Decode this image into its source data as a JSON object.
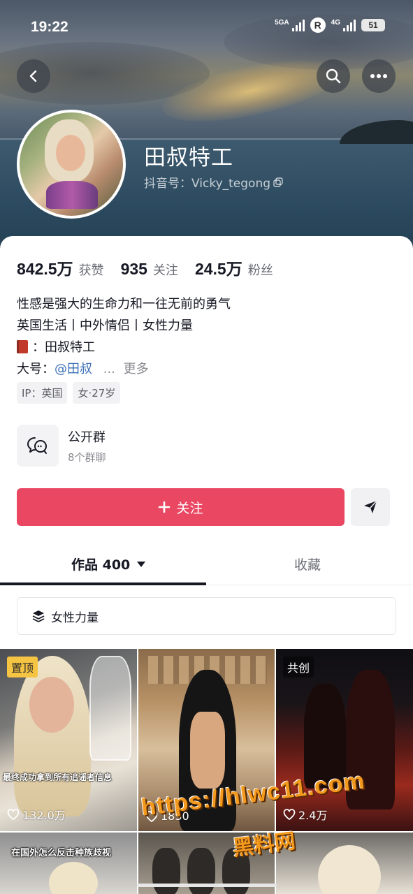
{
  "status_bar": {
    "time": "19:22",
    "network1": "5GA",
    "roaming": "R",
    "network2": "4G",
    "battery": "51"
  },
  "profile": {
    "name": "田叔特工",
    "douyin_id": "抖音号：Vicky_tegong"
  },
  "stats": [
    {
      "value": "842.5万",
      "label": "获赞"
    },
    {
      "value": "935",
      "label": "关注"
    },
    {
      "value": "24.5万",
      "label": "粉丝"
    }
  ],
  "bio": {
    "line1": "性感是强大的生命力和一往无前的勇气",
    "line2": "英国生活丨中外情侣丨女性力量",
    "line3_text": "：田叔特工",
    "line4_prefix": "大号：",
    "line4_link": "@田叔",
    "line4_ellipsis": "...",
    "more": "更多"
  },
  "tags": [
    "IP：英国",
    "女·27岁"
  ],
  "group": {
    "title": "公开群",
    "subtitle": "8个群聊"
  },
  "actions": {
    "follow_label": "关注"
  },
  "tabs": {
    "works": "作品 400",
    "favorites": "收藏"
  },
  "collection": {
    "label": "女性力量"
  },
  "videos": [
    {
      "badge": "置顶",
      "caption": "最终成功拿到所有追谣者信息",
      "likes": "132.0万"
    },
    {
      "badge": "",
      "caption": "",
      "likes": "1830"
    },
    {
      "badge": "共创",
      "caption": "",
      "likes": "2.4万"
    },
    {
      "caption": "在国外怎么反击种族歧视"
    }
  ],
  "watermark": {
    "url": "https://hlwc11.com",
    "name": "黑料网"
  },
  "colors": {
    "follow_button": "#ea4763",
    "link": "#3b6fb6",
    "pinned_badge": "#f6c443",
    "watermark": "#f39a1e"
  }
}
